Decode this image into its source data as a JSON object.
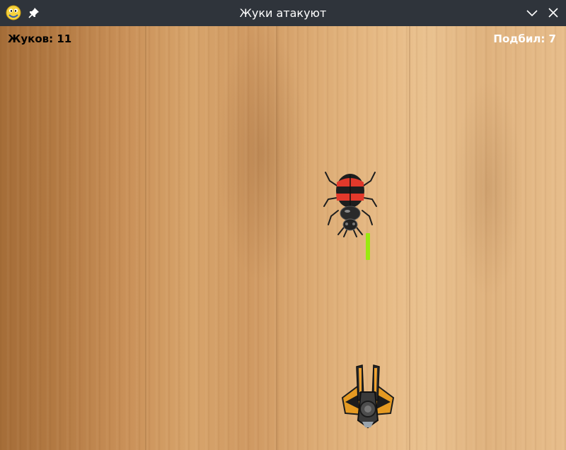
{
  "window": {
    "title": "Жуки атакуют"
  },
  "hud": {
    "bugs_label": "Жуков: 11",
    "hits_label": "Подбил: 7"
  },
  "colors": {
    "titlebar_bg": "#2f343b",
    "laser": "#9aea10",
    "beetle_red": "#e2392b",
    "beetle_black": "#1e1e1e"
  },
  "icons": {
    "app": "python-snake-icon",
    "pin": "pin-icon",
    "minimize": "chevron-down-icon",
    "close": "close-icon"
  }
}
